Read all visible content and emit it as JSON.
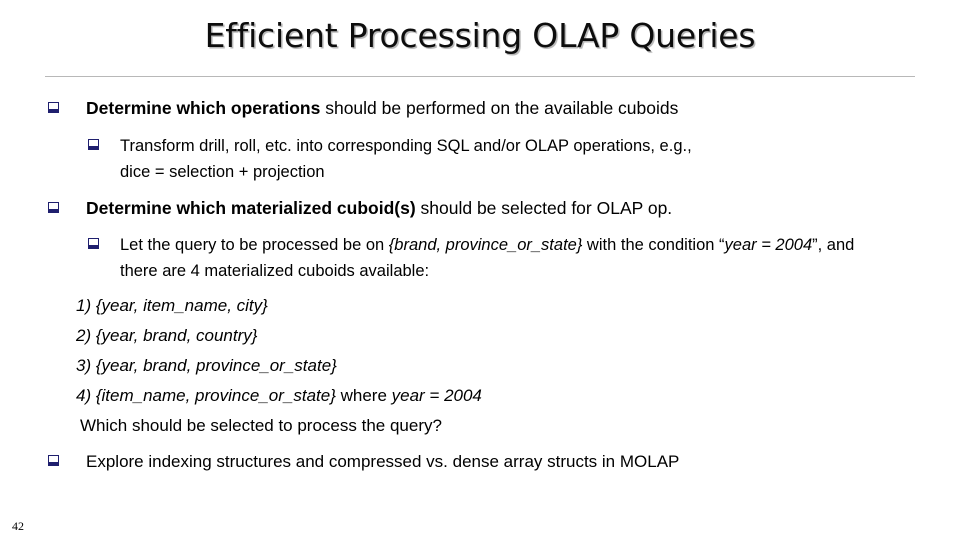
{
  "slide": {
    "title": "Efficient Processing OLAP Queries",
    "page_number": "42",
    "bullet_glyph": "square-bullet",
    "bullet_color": "#1f1f6e",
    "background_color": "#ffffff",
    "text_color": "#000000",
    "rule_color": "#b8b8b8"
  },
  "content": {
    "bullet1": {
      "bold_lead": "Determine which operations",
      "rest": " should be performed on the available cuboids"
    },
    "sub1": {
      "line1": "Transform drill, roll, etc. into corresponding SQL and/or OLAP operations, e.g.,",
      "line2": "dice = selection + projection"
    },
    "bullet2": {
      "bold_lead": "Determine which materialized cuboid(s)",
      "rest": " should be selected for OLAP op."
    },
    "sub2": {
      "lead": "Let the query to be processed be on ",
      "query_dims": "{brand, province_or_state}",
      "mid": " with the condition “",
      "condition": "year = 2004",
      "tail": "”, and there are 4 materialized cuboids available:"
    },
    "cuboids": [
      "1) {year, item_name, city}",
      "2) {year, brand, country}",
      "3) {year, brand, province_or_state}"
    ],
    "cuboid4": {
      "italic_part": "4) {item_name, province_or_state}",
      "where_word": "  where ",
      "condition": "year = 2004"
    },
    "question": "Which should be selected to process the query?",
    "bullet3": {
      "text": "Explore indexing structures and compressed vs. dense array structs in MOLAP"
    }
  }
}
